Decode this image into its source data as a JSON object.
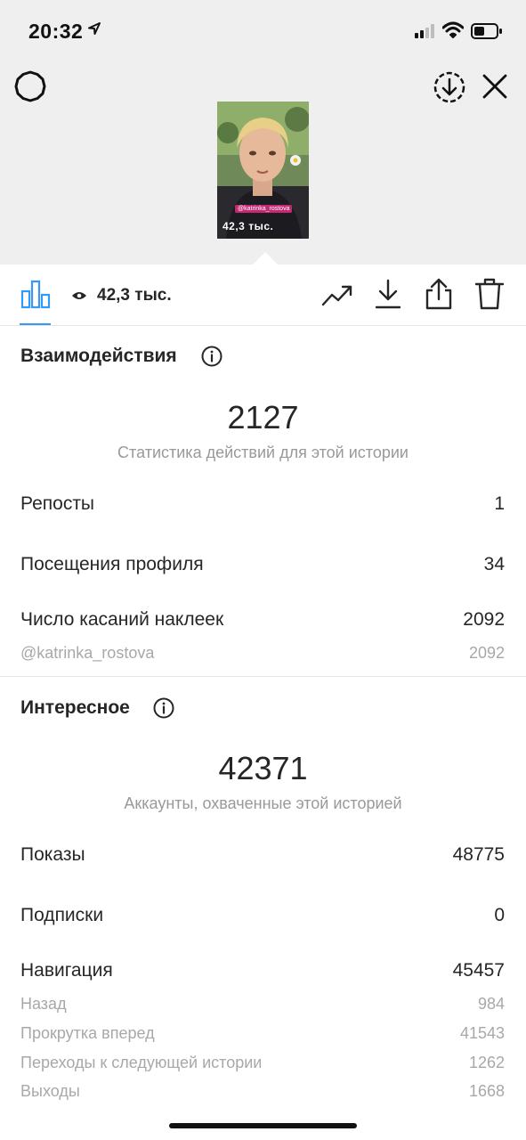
{
  "status_bar": {
    "time": "20:32",
    "icons": [
      "location-arrow-icon",
      "signal-icon",
      "wifi-icon",
      "battery-icon"
    ]
  },
  "header": {
    "icons": [
      "settings-icon",
      "download-circle-icon",
      "close-icon"
    ]
  },
  "story_preview": {
    "mention": "@katrinka_rostova",
    "overlay_text": "42,3 тыс."
  },
  "toolbar": {
    "views": "42,3 тыс.",
    "icons": [
      "bar-chart-icon",
      "eye-icon",
      "trending-icon",
      "download-icon",
      "share-icon",
      "trash-icon"
    ]
  },
  "interactions": {
    "title": "Взаимодействия",
    "total": "2127",
    "caption": "Статистика действий для этой истории",
    "rows": [
      {
        "label": "Репосты",
        "value": "1"
      },
      {
        "label": "Посещения профиля",
        "value": "34"
      },
      {
        "label": "Число касаний наклеек",
        "value": "2092"
      }
    ],
    "subrows": [
      {
        "label": "@katrinka_rostova",
        "value": "2092"
      }
    ]
  },
  "discovery": {
    "title": "Интересное",
    "total": "42371",
    "caption": "Аккаунты, охваченные этой историей",
    "rows": [
      {
        "label": "Показы",
        "value": "48775"
      },
      {
        "label": "Подписки",
        "value": "0"
      },
      {
        "label": "Навигация",
        "value": "45457"
      }
    ],
    "subrows": [
      {
        "label": "Назад",
        "value": "984"
      },
      {
        "label": "Прокрутка вперед",
        "value": "41543"
      },
      {
        "label": "Переходы к следующей истории",
        "value": "1262"
      },
      {
        "label": "Выходы",
        "value": "1668"
      }
    ]
  },
  "colors": {
    "accent": "#3897f0",
    "top_background": "#efefef",
    "secondary_text": "#999999",
    "story_tag": "#c12a72"
  }
}
